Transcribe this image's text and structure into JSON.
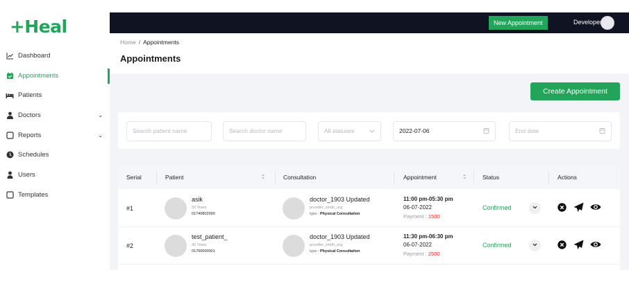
{
  "logo": {
    "plus": "+",
    "text": "Heal"
  },
  "sidebar": {
    "items": [
      {
        "label": "Dashboard",
        "icon": "chart-line-icon",
        "active": false
      },
      {
        "label": "Appointments",
        "icon": "calendar-check-icon",
        "active": true
      },
      {
        "label": "Patients",
        "icon": "bed-icon",
        "active": false
      },
      {
        "label": "Doctors",
        "icon": "doctor-icon",
        "active": false,
        "chevron": "⌄"
      },
      {
        "label": "Reports",
        "icon": "report-icon",
        "active": false,
        "chevron": "⌄"
      },
      {
        "label": "Schedules",
        "icon": "clock-icon",
        "active": false
      },
      {
        "label": "Users",
        "icon": "user-icon",
        "active": false
      },
      {
        "label": "Templates",
        "icon": "template-icon",
        "active": false
      }
    ]
  },
  "topbar": {
    "new_appointment": "New Appointment",
    "user": "Developer"
  },
  "breadcrumb": {
    "home": "Home",
    "sep": "/",
    "current": "Appointments"
  },
  "page_title": "Appointments",
  "create_button": "Create Appointment",
  "filters": {
    "patient_placeholder": "Search patient name",
    "doctor_placeholder": "Search doctor name",
    "status_value": "All statuses",
    "start_date": "2022-07-06",
    "end_date_placeholder": "End date"
  },
  "table": {
    "headers": {
      "serial": "Serial",
      "patient": "Patient",
      "consultation": "Consultation",
      "appointment": "Appointment",
      "status": "Status",
      "actions": "Actions"
    },
    "rows": [
      {
        "serial": "#1",
        "patient_name": "asik",
        "patient_age": "32 Years",
        "patient_phone": "01740802099",
        "doctor": "doctor_1903 Updated",
        "org": "provider_smith_org",
        "type_label": "type : ",
        "type_value": "Physical Consultation",
        "time": "11:00 pm-05:30 pm",
        "date": "06-07-2022",
        "payment_label": "Payment : ",
        "payment_amount": "1500",
        "status": "Confirmed"
      },
      {
        "serial": "#2",
        "patient_name": "test_patient_",
        "patient_age": "30 Years",
        "patient_phone": "01700000001",
        "doctor": "doctor_1903 Updated",
        "org": "provider_smith_org",
        "type_label": "type : ",
        "type_value": "Physical Consultation",
        "time": "11:30 pm-06:30 pm",
        "date": "06-07-2022",
        "payment_label": "Payment : ",
        "payment_amount": "2500",
        "status": "Confirmed"
      }
    ]
  },
  "colors": {
    "brand": "#22a55a",
    "topbar": "#101322",
    "content_bg": "#f3f4f8",
    "payment_amount": "#e02424"
  }
}
